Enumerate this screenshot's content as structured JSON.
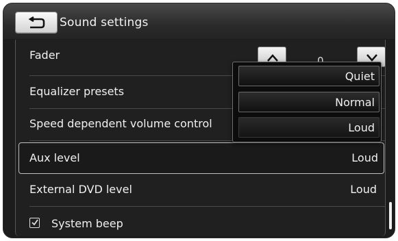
{
  "header": {
    "title": "Sound settings",
    "back_icon": "back-arrow-icon"
  },
  "settings": {
    "fader": {
      "label": "Fader",
      "value": "0",
      "up_icon": "chevron-up-icon",
      "down_icon": "chevron-down-icon"
    },
    "equalizer": {
      "label": "Equalizer presets"
    },
    "speed_volume": {
      "label": "Speed dependent volume control"
    },
    "aux_level": {
      "label": "Aux level",
      "value": "Loud"
    },
    "dvd_level": {
      "label": "External DVD level",
      "value": "Loud"
    },
    "system_beep": {
      "label": "System beep",
      "checked": true,
      "icon": "checkbox-checked-icon"
    }
  },
  "dropdown": {
    "options": [
      "Quiet",
      "Normal",
      "Loud"
    ],
    "selected": "Normal"
  },
  "colors": {
    "background": "#1c1c1c",
    "text": "#f0f0f0",
    "button": "#e0e0e0"
  }
}
